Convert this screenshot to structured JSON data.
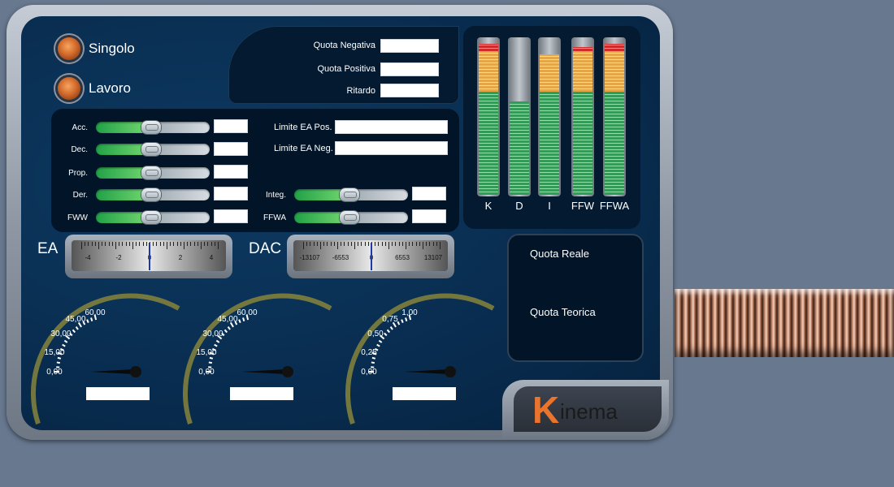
{
  "modes": [
    {
      "label": "Singolo"
    },
    {
      "label": "Lavoro"
    }
  ],
  "quota": {
    "negativa_label": "Quota Negativa",
    "positiva_label": "Quota Positiva",
    "ritardo_label": "Ritardo",
    "negativa_value": "",
    "positiva_value": "",
    "ritardo_value": ""
  },
  "params_left": [
    {
      "label": "Acc.",
      "value": ""
    },
    {
      "label": "Dec.",
      "value": ""
    },
    {
      "label": "Prop.",
      "value": ""
    },
    {
      "label": "Der.",
      "value": ""
    },
    {
      "label": "FWW",
      "value": ""
    }
  ],
  "limits": [
    {
      "label": "Limite EA Pos.",
      "value": ""
    },
    {
      "label": "Limite EA Neg.",
      "value": ""
    }
  ],
  "params_right": [
    {
      "label": "Integ.",
      "value": ""
    },
    {
      "label": "FFWA",
      "value": ""
    }
  ],
  "bars": [
    {
      "label": "K",
      "level": 0.97
    },
    {
      "label": "D",
      "level": 0.6
    },
    {
      "label": "I",
      "level": 0.9
    },
    {
      "label": "FFW",
      "level": 0.95
    },
    {
      "label": "FFWA",
      "level": 0.97
    }
  ],
  "meters": [
    {
      "label": "EA",
      "ticks": [
        "-4",
        "-2",
        "0",
        "2",
        "4"
      ]
    },
    {
      "label": "DAC",
      "ticks": [
        "-13107",
        "-6553",
        "0",
        "6553",
        "13107"
      ]
    }
  ],
  "quote": {
    "reale_label": "Quota Reale",
    "teorica_label": "Quota Teorica"
  },
  "gauges": [
    {
      "ticks": [
        "0,00",
        "15,00",
        "30,00",
        "45,00",
        "60,00"
      ],
      "value": ""
    },
    {
      "ticks": [
        "0,00",
        "15,00",
        "30,00",
        "45,00",
        "60,00"
      ],
      "value": ""
    },
    {
      "ticks": [
        "0,00",
        "0,25",
        "0,50",
        "0,75",
        "1,00"
      ],
      "value": ""
    }
  ],
  "brand": {
    "name": "Kinema",
    "k_glyph": "K",
    "rest": "inema",
    "accent": "#e9742d"
  }
}
